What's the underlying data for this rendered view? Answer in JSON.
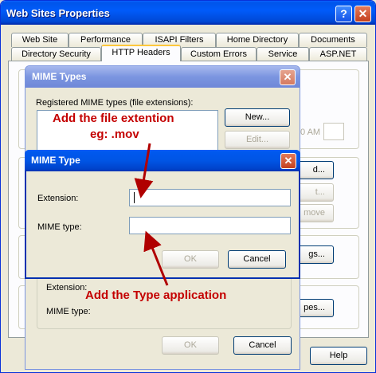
{
  "outer": {
    "title": "Web Sites Properties",
    "help_glyph": "?",
    "close_glyph": "✕",
    "tabs_row1": [
      "Web Site",
      "Performance",
      "ISAPI Filters",
      "Home Directory",
      "Documents"
    ],
    "tabs_row2": [
      "Directory Security",
      "HTTP Headers",
      "Custom Errors",
      "Service",
      "ASP.NET"
    ],
    "active_tab": "HTTP Headers",
    "partial_buttons": [
      "d...",
      "t...",
      "move",
      "gs...",
      "pes..."
    ],
    "partial_time": "0 AM",
    "help_button": "Help"
  },
  "mime_types_dialog": {
    "title": "MIME Types",
    "close_glyph": "✕",
    "list_label": "Registered MIME types (file extensions):",
    "new_button": "New...",
    "edit_button": "Edit...",
    "extension_label": "Extension:",
    "mime_type_label": "MIME type:",
    "ok_button": "OK",
    "cancel_button": "Cancel"
  },
  "mime_type_dialog": {
    "title": "MIME Type",
    "close_glyph": "✕",
    "extension_label": "Extension:",
    "extension_value": "",
    "mime_type_label": "MIME type:",
    "mime_type_value": "",
    "ok_button": "OK",
    "cancel_button": "Cancel"
  },
  "annotations": {
    "line1": "Add the file extention",
    "line2": "eg: .mov",
    "line3": "Add the Type application",
    "color": "#c40000"
  }
}
